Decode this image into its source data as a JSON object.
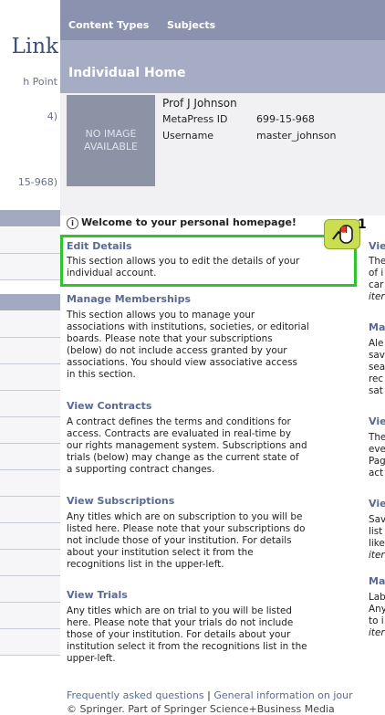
{
  "sidebar": {
    "logo_fragment": "Link",
    "line1": "h Point",
    "line2": "4)",
    "line3": "15-968)"
  },
  "nav": {
    "content_types": "Content Types",
    "subjects": "Subjects"
  },
  "section_title": "Individual Home",
  "profile": {
    "no_image": "NO IMAGE AVAILABLE",
    "name": "Prof J Johnson",
    "metapress_label": "MetaPress ID",
    "metapress_value": "699-15-968",
    "username_label": "Username",
    "username_value": "master_johnson"
  },
  "welcome": "Welcome to your personal homepage!",
  "sections": {
    "edit": {
      "title": "Edit Details",
      "l1": "This section allows you to edit the details of your",
      "l2": "individual account."
    },
    "memberships": {
      "title": "Manage Memberships",
      "l1": "This section allows you to manage your",
      "l2": "associations with institutions, societies, or editorial",
      "l3": "boards. Please note that your subscriptions",
      "l4": "(below) do not include access granted by your",
      "l5": "associations. You should view associative access",
      "l6": "in this section."
    },
    "contracts": {
      "title": "View Contracts",
      "l1": "A contract defines the terms and conditions for",
      "l2": "access. Contracts are evaluated in real-time by",
      "l3": "our rights management system. Subscriptions and",
      "l4": "trials (below) may change as the current state of",
      "l5": "a supporting contract changes."
    },
    "subscriptions": {
      "title": "View Subscriptions",
      "l1": "Any titles which are on subscription to you will be",
      "l2": "listed here. Please note that your subscriptions do",
      "l3": "not include those of your institution. For details",
      "l4": "about your institution select it from the",
      "l5": "recognitions list in the upper-left."
    },
    "trials": {
      "title": "View Trials",
      "l1": "Any titles which are on trial to you will be listed",
      "l2": "here. Please note that your trials do not include",
      "l3": "those of your institution. For details about your",
      "l4": "institution select it from the recognitions list in the",
      "l5": "upper-left."
    }
  },
  "right_col": {
    "h1": "Vie",
    "a1": "The",
    "a2": "of i",
    "a3": "car",
    "a4": "iter",
    "h2": "Ma",
    "b1": "Ale",
    "b2": "sav",
    "b3": "sea",
    "b4": "rec",
    "b5": "sat",
    "h3": "Vie",
    "c1": "The",
    "c2": "eve",
    "c3": "Pag",
    "c4": "act",
    "h4": "Vie",
    "d1": "Sav",
    "d2": "list",
    "d3": "like",
    "d4": "iter",
    "h5": "Ma",
    "e1": "Lab",
    "e2": "Any",
    "e3": "to i",
    "e4": "iter"
  },
  "step_number": "1",
  "footer": {
    "faq": "Frequently asked questions",
    "sep": "|",
    "general": "General information on jour",
    "copyright": "© Springer. Part of Springer Science+Business Media"
  },
  "colors": {
    "highlight": "#2dc52b",
    "header_bar": "#8b92af",
    "link": "#5a6a92"
  }
}
